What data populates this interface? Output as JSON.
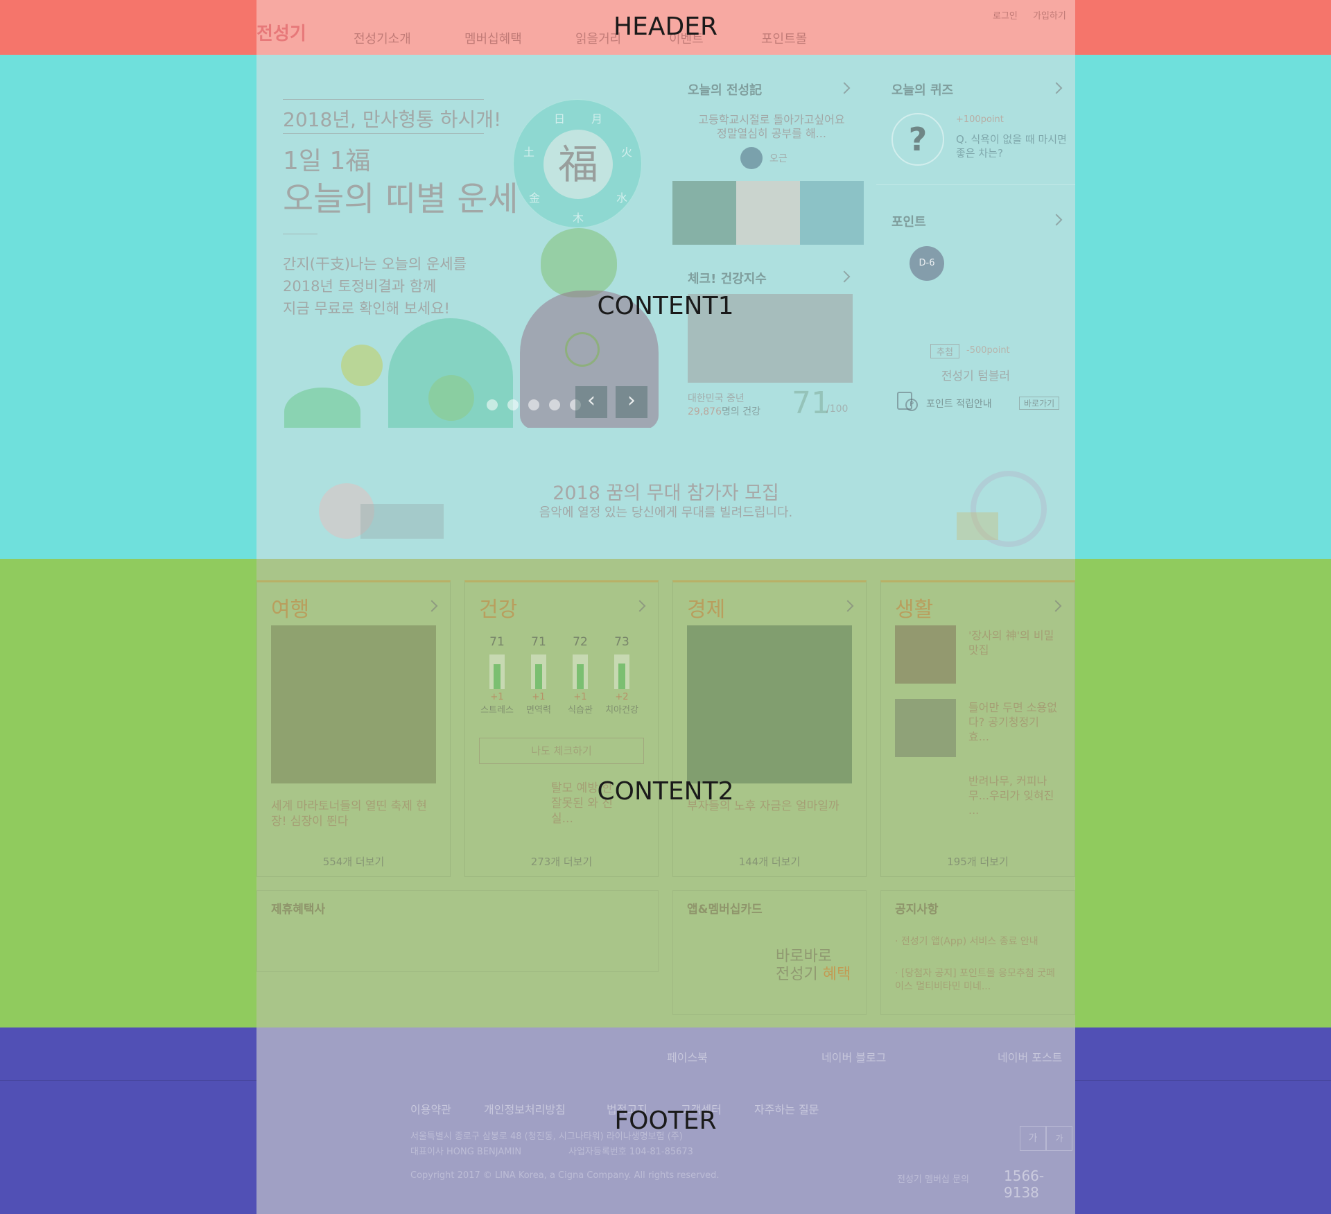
{
  "header": {
    "logo": "전성기",
    "nav": [
      "전성기소개",
      "멤버십혜택",
      "읽을거리",
      "이벤트",
      "포인트몰"
    ],
    "util_links": [
      "로그인",
      "가입하기"
    ]
  },
  "hero": {
    "line1": "2018년, 만사형통 하시개!",
    "line2": "1일 1福",
    "line3": "오늘의 띠별 운세",
    "desc": [
      "간지(干支)나는 오늘의 운세를",
      "2018년 토정비결과 함께",
      "지금 무료로 확인해 보세요!"
    ],
    "wheel_center": "福",
    "wheel_chars": [
      "日",
      "月",
      "火",
      "水",
      "木",
      "金",
      "土"
    ],
    "prev_label": "‹",
    "next_label": "›",
    "dots": 5
  },
  "today_story": {
    "title": "오늘의 전성記",
    "text": "고등학교시절로 돌아가고싶어요 정말열심히 공부를 해...",
    "author": "오근"
  },
  "health_check": {
    "title": "체크! 건강지수",
    "caption1": "대한민국 중년",
    "caption_num": "29,876",
    "caption2": "명의 건강",
    "score": "71",
    "score_max": "/100"
  },
  "quiz": {
    "title": "오늘의 퀴즈",
    "points": "+100point",
    "question": "Q. 식욕이 없을 때 마시면 좋은 차는?"
  },
  "point": {
    "title": "포인트",
    "dday": "D-6",
    "tag": "추첨",
    "tag_points": "-500point",
    "item": "전성기 텀블러",
    "guide": "포인트 적립안내",
    "guide_btn": "바로가기"
  },
  "banner": {
    "title": "2018 꿈의 무대 참가자 모집",
    "sub": "음악에 열정 있는 당신에게 무대를 빌려드립니다."
  },
  "travel": {
    "title": "여행",
    "caption": "세계 마라토너들의 열띤 축제 현장! 심장이 뛴다",
    "more": "554개 더보기"
  },
  "health": {
    "title": "건강",
    "bars": [
      {
        "value": "71",
        "delta": "+1",
        "name": "스트레스"
      },
      {
        "value": "71",
        "delta": "+1",
        "name": "면역력"
      },
      {
        "value": "72",
        "delta": "+1",
        "name": "식습관"
      },
      {
        "value": "73",
        "delta": "+2",
        "name": "치아건강"
      }
    ],
    "check_btn": "나도 체크하기",
    "article": "탈모 예방 한 잘못된 와 진실...",
    "more": "273개 더보기"
  },
  "economy": {
    "title": "경제",
    "caption": "부자들의 노후 자금은 얼마일까",
    "more": "144개 더보기"
  },
  "life": {
    "title": "생활",
    "items": [
      "'장사의 神'의 비밀 맛집",
      "틀어만 두면 소용없다? 공기청정기 효...",
      "반려나무, 커피나무...우리가 잊혀진 ..."
    ],
    "more": "195개 더보기"
  },
  "partners": {
    "title": "제휴혜택사"
  },
  "app": {
    "title": "앱&멤버십카드",
    "line1": "바로바로",
    "line2a": "전성기 ",
    "line2b": "혜택"
  },
  "notice": {
    "title": "공지사항",
    "items": [
      "전성기 앱(App) 서비스 종료 안내",
      "[당첨자 공지] 포인트몰 응모추첨 굿페이스 멀티비타민 미네..."
    ]
  },
  "sns": [
    "페이스북",
    "네이버 블로그",
    "네이버 포스트"
  ],
  "footer": {
    "links": [
      "이용약관",
      "개인정보처리방침",
      "법적고지",
      "고객센터",
      "자주하는 질문"
    ],
    "addr1": "서울특별시 종로구 삼봉로 48 (청진동, 시그나타워) 라이나생명보험 (주)",
    "ceo": "대표이사 HONG BENJAMIN",
    "biz": "사업자등록번호 104-81-85673",
    "copyright": "Copyright 2017 © LINA Korea, a Cigna Company. All rights reserved.",
    "font_up": "가",
    "font_down": "가",
    "cs_label": "전성기 멤버십 문의",
    "cs_phone": "1566-9138"
  },
  "overlay_labels": {
    "header": "HEADER",
    "content1": "CONTENT1",
    "content2": "CONTENT2",
    "footer": "FOOTER"
  },
  "colors": {
    "header_band": "#f5756b",
    "content1_band": "#6fe0dc",
    "content2_band": "#90cb5e",
    "footer_band": "#5150b5"
  }
}
